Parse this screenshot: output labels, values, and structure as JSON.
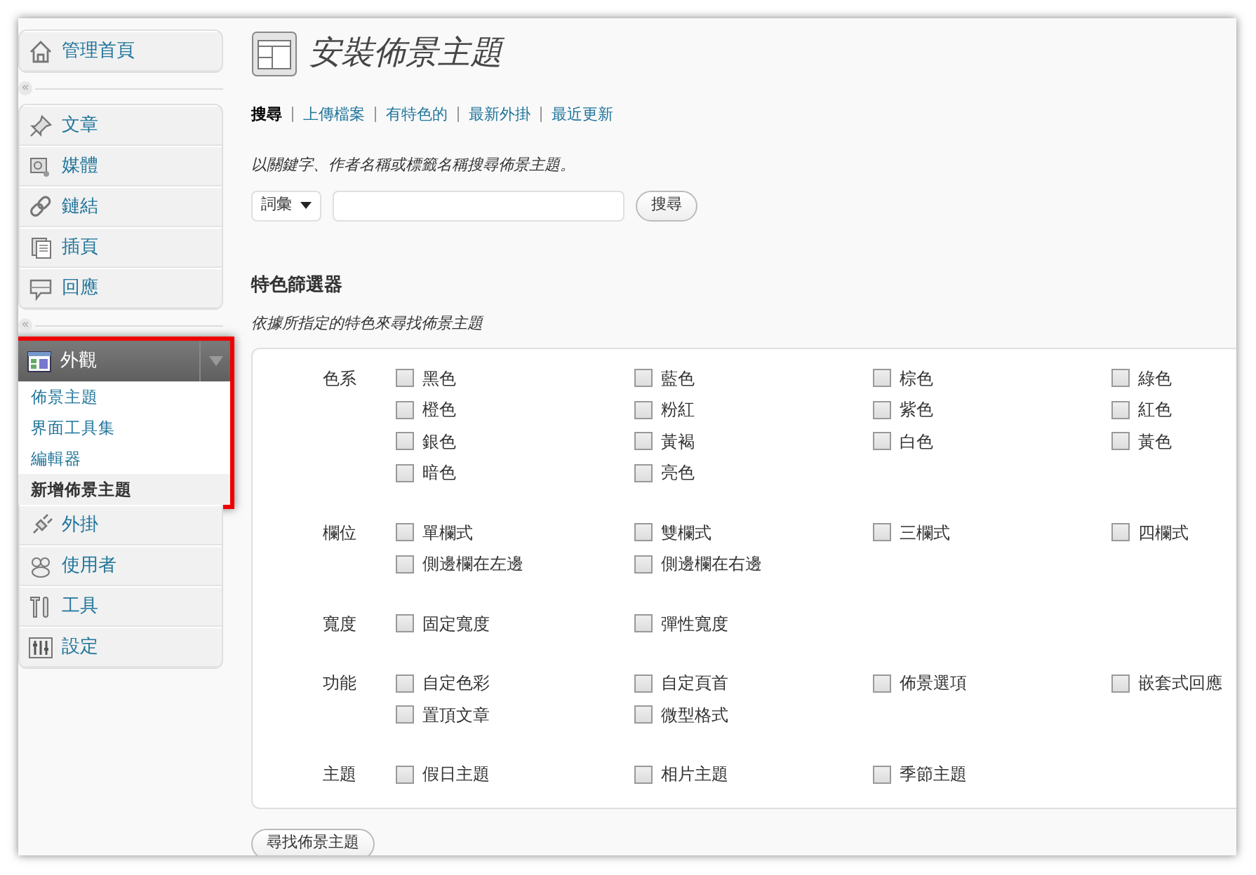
{
  "sidebar": {
    "menu": [
      {
        "kind": "item",
        "label": "管理首頁"
      },
      {
        "kind": "separator",
        "text": "«"
      },
      {
        "kind": "item",
        "label": "文章"
      },
      {
        "kind": "item",
        "label": "媒體"
      },
      {
        "kind": "item",
        "label": "鏈結"
      },
      {
        "kind": "item",
        "label": "插頁"
      },
      {
        "kind": "item",
        "label": "回應"
      },
      {
        "kind": "separator",
        "text": "«"
      },
      {
        "kind": "item",
        "label": "外觀",
        "expanded": true,
        "submenu": [
          {
            "label": "佈景主題",
            "selected": false
          },
          {
            "label": "界面工具集",
            "selected": false
          },
          {
            "label": "編輯器",
            "selected": false
          },
          {
            "label": "新增佈景主題",
            "selected": true
          }
        ]
      },
      {
        "kind": "item",
        "label": "外掛"
      },
      {
        "kind": "item",
        "label": "使用者"
      },
      {
        "kind": "item",
        "label": "工具"
      },
      {
        "kind": "item",
        "label": "設定"
      }
    ]
  },
  "page": {
    "title": "安裝佈景主題",
    "tabs": [
      {
        "label": "搜尋",
        "selected": true
      },
      {
        "label": "上傳檔案",
        "selected": false
      },
      {
        "label": "有特色的",
        "selected": false
      },
      {
        "label": "最新外掛",
        "selected": false
      },
      {
        "label": "最近更新",
        "selected": false
      }
    ],
    "search": {
      "description": "以關鍵字、作者名稱或標籤名稱搜尋佈景主題。",
      "type_select": "詞彙",
      "button": "搜尋"
    },
    "filter": {
      "heading": "特色篩選器",
      "description": "依據所指定的特色來尋找佈景主題",
      "groups": [
        {
          "label": "色系",
          "options": [
            {
              "label": "黑色",
              "checked": false
            },
            {
              "label": "藍色",
              "checked": false
            },
            {
              "label": "棕色",
              "checked": false
            },
            {
              "label": "綠色",
              "checked": false
            },
            {
              "label": "橙色",
              "checked": false
            },
            {
              "label": "粉紅",
              "checked": false
            },
            {
              "label": "紫色",
              "checked": false
            },
            {
              "label": "紅色",
              "checked": false
            },
            {
              "label": "銀色",
              "checked": false
            },
            {
              "label": "黃褐",
              "checked": false
            },
            {
              "label": "白色",
              "checked": false
            },
            {
              "label": "黃色",
              "checked": false
            },
            {
              "label": "暗色",
              "checked": false
            },
            {
              "label": "亮色",
              "checked": false
            }
          ]
        },
        {
          "label": "欄位",
          "options": [
            {
              "label": "單欄式",
              "checked": false
            },
            {
              "label": "雙欄式",
              "checked": false
            },
            {
              "label": "三欄式",
              "checked": false
            },
            {
              "label": "四欄式",
              "checked": false
            },
            {
              "label": "側邊欄在左邊",
              "checked": false
            },
            {
              "label": "側邊欄在右邊",
              "checked": false
            }
          ]
        },
        {
          "label": "寬度",
          "options": [
            {
              "label": "固定寬度",
              "checked": false
            },
            {
              "label": "彈性寬度",
              "checked": false
            }
          ]
        },
        {
          "label": "功能",
          "options": [
            {
              "label": "自定色彩",
              "checked": false
            },
            {
              "label": "自定頁首",
              "checked": false
            },
            {
              "label": "佈景選項",
              "checked": false
            },
            {
              "label": "嵌套式回應",
              "checked": false
            },
            {
              "label": "置頂文章",
              "checked": false
            },
            {
              "label": "微型格式",
              "checked": false
            }
          ]
        },
        {
          "label": "主題",
          "options": [
            {
              "label": "假日主題",
              "checked": false
            },
            {
              "label": "相片主題",
              "checked": false
            },
            {
              "label": "季節主題",
              "checked": false
            }
          ]
        }
      ],
      "button": "尋找佈景主題"
    }
  }
}
